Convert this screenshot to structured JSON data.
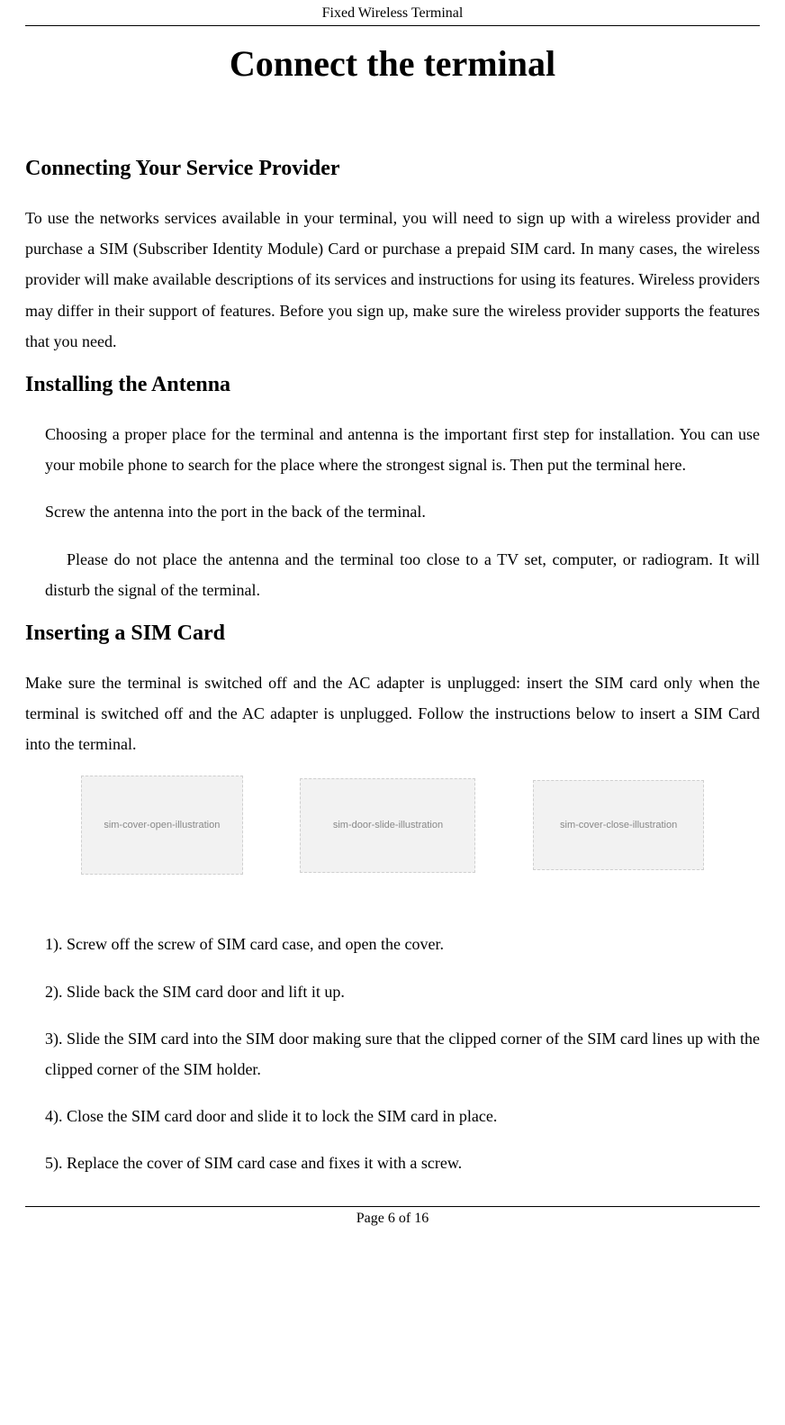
{
  "header": {
    "running_title": "Fixed Wireless Terminal"
  },
  "title": "Connect the terminal",
  "sections": {
    "s1": {
      "heading": "Connecting Your Service Provider",
      "p1": "To use the networks services available in your terminal, you will need to sign up with a wireless provider and purchase a SIM (Subscriber Identity Module) Card or purchase a prepaid SIM card. In many cases, the wireless provider will make available descriptions of its services and instructions for using its features. Wireless providers may differ in their support of features. Before you sign up, make sure the wireless provider supports the features that you need."
    },
    "s2": {
      "heading": "Installing the Antenna",
      "p1": "Choosing a proper place for the terminal and antenna is the important first step for installation. You can use your mobile phone to search for the place where the strongest signal is. Then put the terminal here.",
      "p2": "Screw the antenna into the port in the back of the terminal.",
      "p3": "Please do not place the antenna and the terminal too close to a TV set, computer, or radiogram. It will disturb the signal of the terminal."
    },
    "s3": {
      "heading": "Inserting a SIM Card",
      "p1": "Make sure the terminal is switched off and the AC adapter is unplugged: insert the SIM card only when the terminal is switched off and the AC adapter is unplugged. Follow the instructions below to insert a SIM Card into the terminal.",
      "images": {
        "i1": "sim-cover-open-illustration",
        "i2": "sim-door-slide-illustration",
        "i3": "sim-cover-close-illustration"
      },
      "steps": {
        "st1": "1). Screw off the screw of SIM card case, and open the cover.",
        "st2": "2). Slide back the SIM card door and lift it up.",
        "st3": "3). Slide the SIM card into the SIM door making sure that the clipped corner of the SIM card lines up with the clipped corner of the SIM holder.",
        "st4": "4). Close the SIM card door and slide it to lock the SIM card in place.",
        "st5": "5). Replace the cover of SIM card case and fixes it with a screw."
      }
    }
  },
  "footer": {
    "page_indicator": "Page 6 of 16"
  }
}
